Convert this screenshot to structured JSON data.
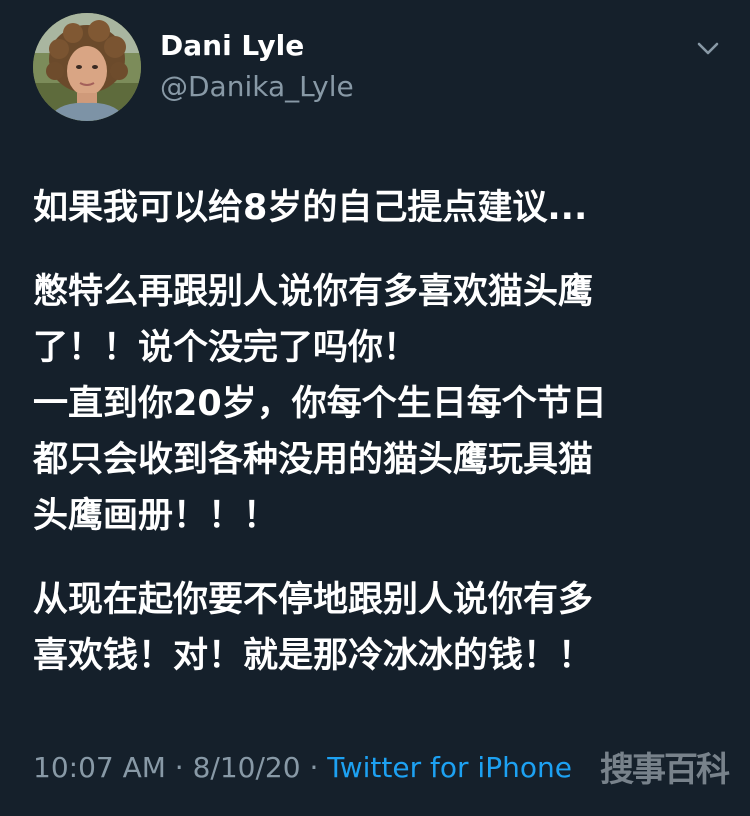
{
  "author": {
    "display_name": "Dani Lyle",
    "handle": "@Danika_Lyle"
  },
  "tweet": {
    "paragraphs": [
      [
        "如果我可以给8岁的自己提点建议..."
      ],
      [
        "憋特么再跟别人说你有多喜欢猫头鹰",
        "了！！说个没完了吗你！",
        "一直到你20岁，你每个生日每个节日",
        "都只会收到各种没用的猫头鹰玩具猫",
        "头鹰画册！！！"
      ],
      [
        "从现在起你要不停地跟别人说你有多",
        "喜欢钱！对！就是那冷冰冰的钱！！"
      ]
    ]
  },
  "meta": {
    "time": "10:07 AM",
    "sep1": " · ",
    "date": "8/10/20",
    "sep2": " · ",
    "source": "Twitter for iPhone"
  },
  "watermark": "搜事百科",
  "icons": {
    "menu": "chevron-down-icon"
  },
  "colors": {
    "background": "#15202b",
    "secondary_text": "#8899a6",
    "link": "#1da1f2"
  }
}
